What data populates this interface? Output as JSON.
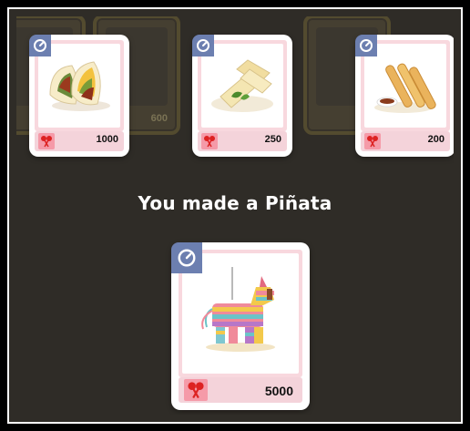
{
  "title": "You made a Piñata",
  "background_cards": [
    {
      "cost": "600"
    }
  ],
  "cards": [
    {
      "name": "Tacos",
      "cost": "1000",
      "icon": "taco-icon"
    },
    {
      "name": "Tamales",
      "cost": "250",
      "icon": "tamale-icon"
    },
    {
      "name": "Churros",
      "cost": "200",
      "icon": "churro-icon"
    }
  ],
  "result_card": {
    "name": "Piñata",
    "cost": "5000",
    "icon": "pinata-icon"
  },
  "colors": {
    "background": "#2f2c27",
    "badge": "#6c7fb0",
    "card_pink": "#f8d8de",
    "maraca_badge": "#f59aa8"
  }
}
